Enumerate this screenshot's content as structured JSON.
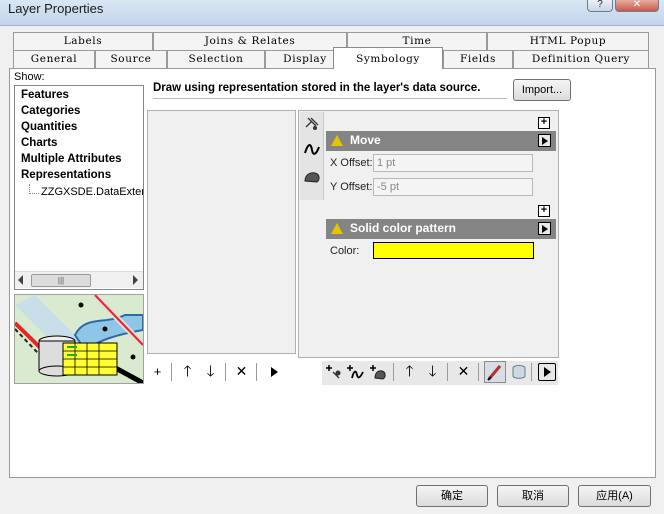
{
  "window": {
    "title": "Layer Properties",
    "help_label": "?",
    "close_label": "✕"
  },
  "tabs": {
    "row1": [
      "Labels",
      "Joins & Relates",
      "Time",
      "HTML Popup"
    ],
    "row2": [
      "General",
      "Source",
      "Selection",
      "Display",
      "Symbology",
      "Fields",
      "Definition Query"
    ],
    "active": "Symbology"
  },
  "show": {
    "label": "Show:",
    "categories": [
      "Features",
      "Categories",
      "Quantities",
      "Charts",
      "Multiple Attributes",
      "Representations"
    ],
    "sub_item": "ZZGXSDE.DataExter",
    "scroll_grip": "|||"
  },
  "description": "Draw using representation stored in the layer's data source.",
  "import_button": "Import...",
  "rules_toolbar": {
    "add_icon": "add-icon",
    "up_icon": "arrow-up-icon",
    "down_icon": "arrow-down-icon",
    "delete_icon": "delete-icon",
    "more_icon": "play-icon"
  },
  "effect_move": {
    "title": "Move",
    "x_label": "X Offset:",
    "x_value": "1 pt",
    "y_label": "Y Offset:",
    "y_value": "-5 pt"
  },
  "effect_fill": {
    "title": "Solid color pattern",
    "color_label": "Color:",
    "color": "#ffff00"
  },
  "expand_label": "+",
  "footer": {
    "ok": "确定",
    "cancel": "取消",
    "apply": "应用(A)"
  },
  "colors": {
    "header_bg": "#848484",
    "panel_bg": "#f0f0f0",
    "border": "#9a9a9a",
    "preview_yellow": "#ffff00"
  }
}
